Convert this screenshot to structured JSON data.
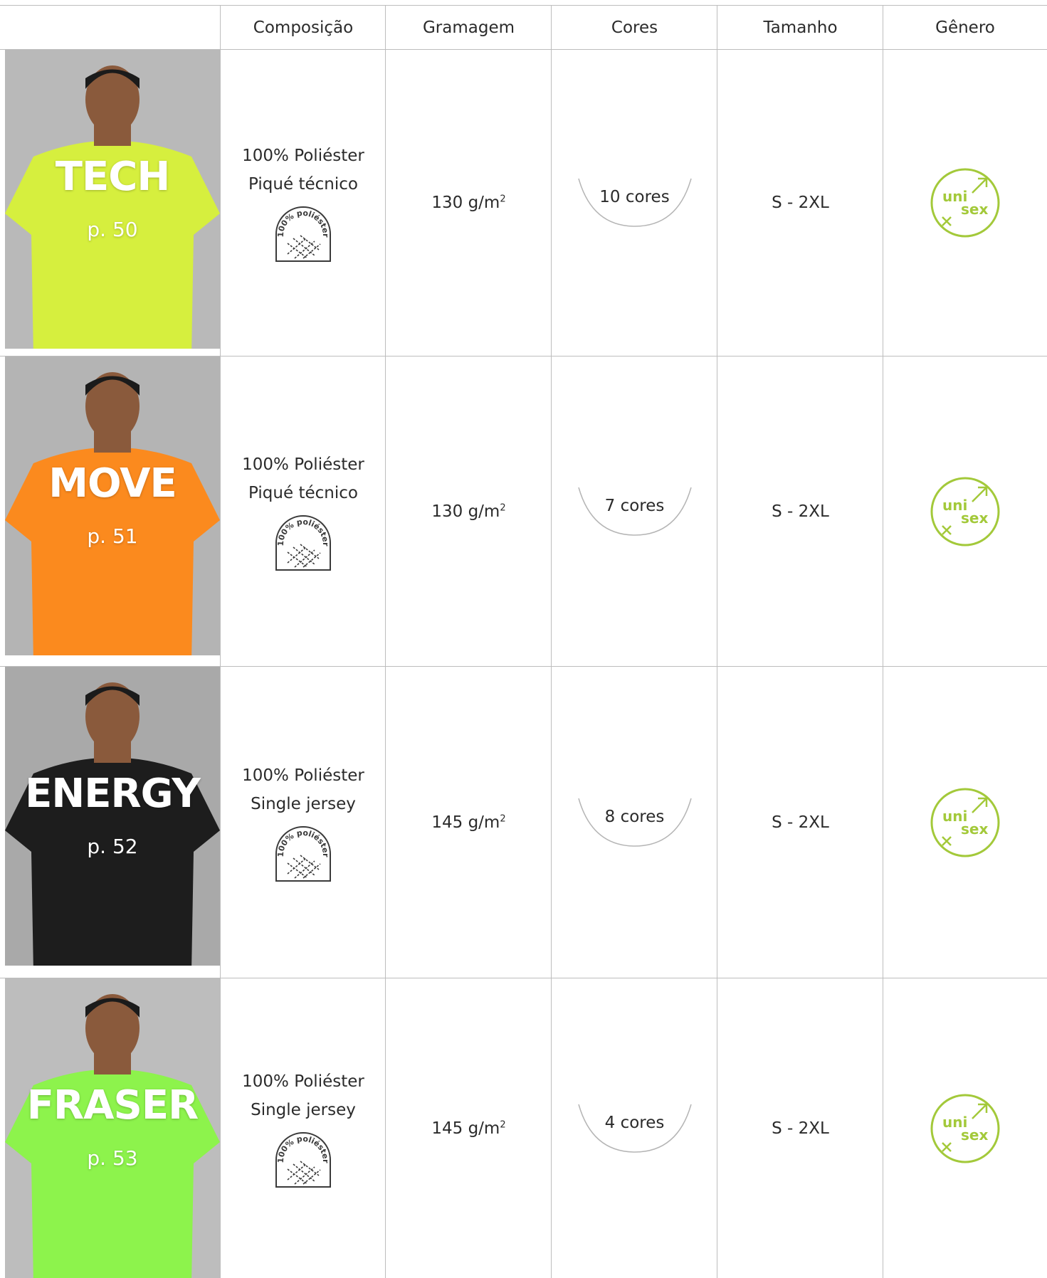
{
  "header": {
    "composicao": "Composição",
    "gramagem": "Gramagem",
    "cores": "Cores",
    "tamanho": "Tamanho",
    "genero": "Gênero"
  },
  "badge": {
    "fabric_label": "100% poliéster"
  },
  "unisex": {
    "uni": "uni",
    "sex": "sex"
  },
  "colors": {
    "unisex_green": "#a3c93a"
  },
  "products": [
    {
      "name": "TECH",
      "page": "p. 50",
      "comp1": "100% Poliéster",
      "comp2": "Piqué técnico",
      "weight": "130 g/m",
      "weight_sup": "2",
      "cores": "10 cores",
      "size": "S - 2XL",
      "shirt_color": "#d6ef3e"
    },
    {
      "name": "MOVE",
      "page": "p. 51",
      "comp1": "100% Poliéster",
      "comp2": "Piqué técnico",
      "weight": "130 g/m",
      "weight_sup": "2",
      "cores": "7 cores",
      "size": "S - 2XL",
      "shirt_color": "#fb8a1e"
    },
    {
      "name": "ENERGY",
      "page": "p. 52",
      "comp1": "100% Poliéster",
      "comp2": "Single jersey",
      "weight": "145 g/m",
      "weight_sup": "2",
      "cores": "8 cores",
      "size": "S - 2XL",
      "shirt_color": "#1d1d1d"
    },
    {
      "name": "FRASER",
      "page": "p. 53",
      "comp1": "100% Poliéster",
      "comp2": "Single jersey",
      "weight": "145 g/m",
      "weight_sup": "2",
      "cores": "4 cores",
      "size": "S - 2XL",
      "shirt_color": "#8df34c"
    }
  ]
}
